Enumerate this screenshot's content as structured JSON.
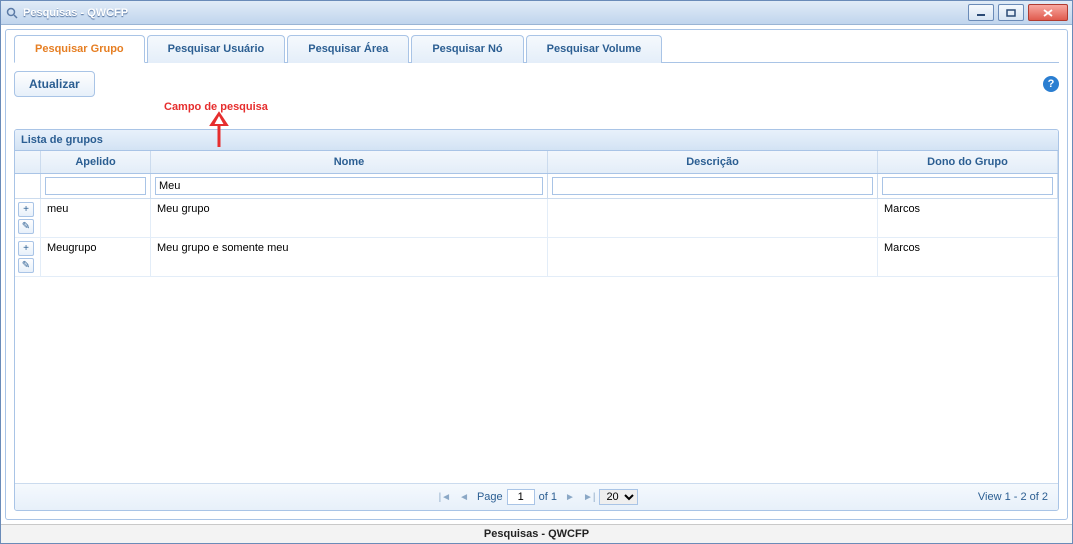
{
  "window": {
    "title": "Pesquisas - QWCFP"
  },
  "tabs": [
    {
      "label": "Pesquisar Grupo",
      "active": true
    },
    {
      "label": "Pesquisar Usuário"
    },
    {
      "label": "Pesquisar Área"
    },
    {
      "label": "Pesquisar Nó"
    },
    {
      "label": "Pesquisar Volume"
    }
  ],
  "toolbar": {
    "refresh": "Atualizar"
  },
  "annotation": "Campo de pesquisa",
  "grid": {
    "title": "Lista de grupos",
    "columns": {
      "apelido": "Apelido",
      "nome": "Nome",
      "descricao": "Descrição",
      "dono": "Dono do Grupo"
    },
    "filters": {
      "apelido": "",
      "nome": "Meu",
      "descricao": "",
      "dono": ""
    },
    "rows": [
      {
        "apelido": "meu",
        "nome": "Meu grupo",
        "descricao": "",
        "dono": "Marcos"
      },
      {
        "apelido": "Meugrupo",
        "nome": "Meu grupo e somente meu",
        "descricao": "",
        "dono": "Marcos"
      }
    ],
    "pager": {
      "page_label": "Page",
      "page": "1",
      "of_label": "of 1",
      "pagesize": "20",
      "viewinfo": "View 1 - 2 of 2"
    }
  },
  "statusbar": "Pesquisas - QWCFP"
}
